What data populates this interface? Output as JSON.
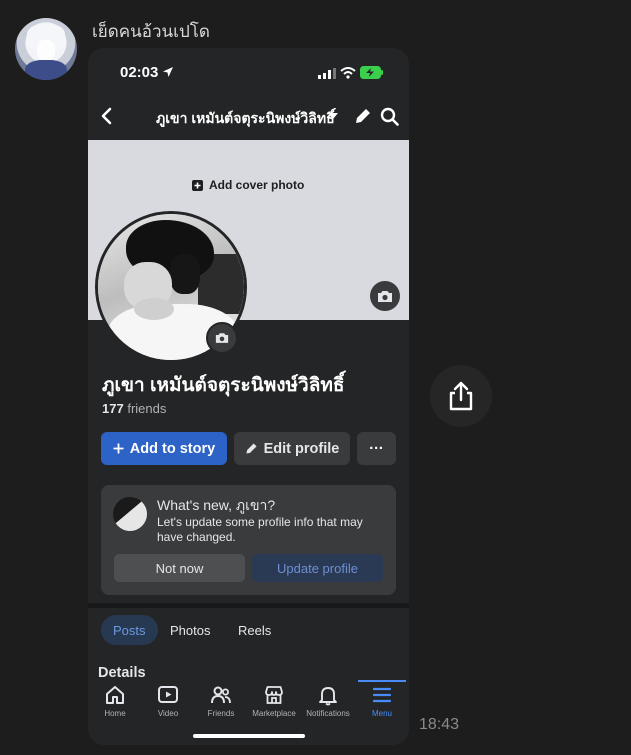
{
  "chat": {
    "sender_name": "เย็ดคนอ้วนเปโด",
    "timestamp": "18:43"
  },
  "phone": {
    "status_bar": {
      "time": "02:03"
    },
    "navbar": {
      "title": "ภูเขา เหมันต์จตุระนิพงษ์วิลิทธิ์"
    },
    "cover": {
      "add_cover_label": "Add cover photo"
    },
    "profile": {
      "name": "ภูเขา เหมันต์จตุระนิพงษ์วิลิทธิ์",
      "friends_count": "177",
      "friends_label": "friends"
    },
    "actions": {
      "add_story": "Add to story",
      "edit_profile": "Edit profile",
      "more": "···"
    },
    "prompt_card": {
      "title": "What's new, ภูเขา?",
      "description": "Let's update some profile info that may have changed.",
      "not_now": "Not now",
      "update_profile": "Update profile"
    },
    "tabs": [
      {
        "label": "Posts",
        "active": true
      },
      {
        "label": "Photos",
        "active": false
      },
      {
        "label": "Reels",
        "active": false
      }
    ],
    "section_title": "Details",
    "bottom_nav": [
      {
        "label": "Home",
        "icon": "home-icon"
      },
      {
        "label": "Video",
        "icon": "video-icon"
      },
      {
        "label": "Friends",
        "icon": "friends-icon"
      },
      {
        "label": "Marketplace",
        "icon": "marketplace-icon"
      },
      {
        "label": "Notifications",
        "icon": "bell-icon"
      },
      {
        "label": "Menu",
        "icon": "menu-icon",
        "active": true
      }
    ]
  },
  "colors": {
    "accent_blue": "#2d62c6",
    "active_nav": "#4a8cf7",
    "dark_surface": "#242526"
  }
}
